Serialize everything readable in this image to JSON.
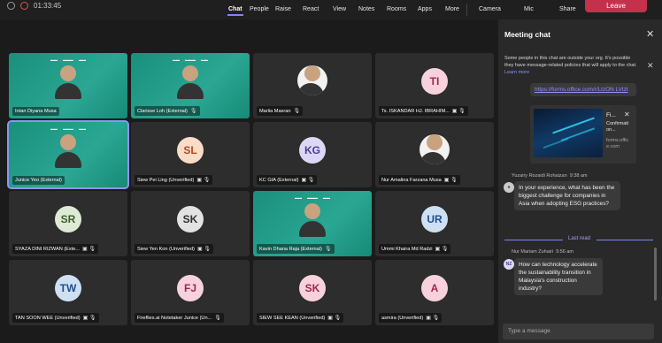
{
  "topbar": {
    "time": "01:33:45",
    "items": [
      "Chat",
      "People",
      "Raise",
      "React",
      "View",
      "Notes",
      "Rooms",
      "Apps",
      "More",
      "Camera",
      "Mic",
      "Share"
    ],
    "leave": "Leave"
  },
  "tiles": [
    {
      "name": "Intan Diyana Musa",
      "type": "video",
      "green": true,
      "icons": ""
    },
    {
      "name": "Clarisse Loh (External)",
      "type": "green",
      "green": true,
      "icons": "🎙"
    },
    {
      "name": "Marlia Masran",
      "type": "photo",
      "icons": "🎙"
    },
    {
      "name": "Ts. ISKANDAR HJ. IBRAHIM...",
      "type": "avatar",
      "initials": "TI",
      "av": "av-pink",
      "icons": "▣ 🎙"
    },
    {
      "name": "Junice Yeo (External)",
      "type": "video",
      "green": true,
      "selected": true,
      "icons": ""
    },
    {
      "name": "Siew Pei Ling (Unverified)",
      "type": "avatar",
      "initials": "SL",
      "av": "av-peach",
      "icons": "▣ 🎙"
    },
    {
      "name": "KC GIA (External)",
      "type": "avatar",
      "initials": "KG",
      "av": "av-lav",
      "icons": "▣ 🎙"
    },
    {
      "name": "Nur Amalina Farzana Musa",
      "type": "photo",
      "icons": "▣ 🎙"
    },
    {
      "name": "SYAZA DINI RIZWAN (Exte...",
      "type": "avatar",
      "initials": "SR",
      "av": "av-sage",
      "icons": "▣ 🎙"
    },
    {
      "name": "Siew Yen Kon (Unverified)",
      "type": "avatar",
      "initials": "SK",
      "av": "av-gray",
      "icons": "▣ 🎙"
    },
    {
      "name": "Kavin Dhana Raja (External)",
      "type": "video",
      "green": true,
      "icons": "🎙"
    },
    {
      "name": "Ummi Khaira Md Radzi",
      "type": "avatar",
      "initials": "UR",
      "av": "av-blue",
      "icons": "▣ 🎙"
    },
    {
      "name": "TAN SOON WEE (Unverified)",
      "type": "avatar",
      "initials": "TW",
      "av": "av-blue",
      "icons": "▣ 🎙"
    },
    {
      "name": "Fireflies.ai Notetaker Junice (Un...",
      "type": "avatar",
      "initials": "FJ",
      "av": "av-pink",
      "icons": "🎙"
    },
    {
      "name": "SIEW SEE KEAN (Unverified)",
      "type": "avatar",
      "initials": "SK",
      "av": "av-pink",
      "icons": "▣ 🎙"
    },
    {
      "name": "asmira (Unverified)",
      "type": "avatar",
      "initials": "A",
      "av": "av-pink",
      "icons": "▣ 🎙"
    }
  ],
  "chat": {
    "title": "Meeting chat",
    "notice": "Some people in this chat are outside your org. It's possible they have message-related policies that will apply to the chat.",
    "learn_more": "Learn more",
    "link_text": "https://forms.office.com/r/LtzON LVtzt",
    "card_title": "Fi...",
    "card_sub": "Confirmati on...",
    "card_domain": "forms.offic e.com",
    "msg1_author": "Yuzairy Rozaidi Rohaizan",
    "msg1_time": "9:38 am",
    "msg1_text": "In your experience, what has been the biggest challenge for companies in Asia when adopting ESG practices?",
    "last_read": "Last read",
    "msg2_author": "Nur Mariam Zuhairi",
    "msg2_time": "9:56 am",
    "msg2_initials": "NZ",
    "msg2_text": "How can technology accelerate the sustainability transition in Malaysia's construction industry?",
    "placeholder": "Type a message"
  }
}
